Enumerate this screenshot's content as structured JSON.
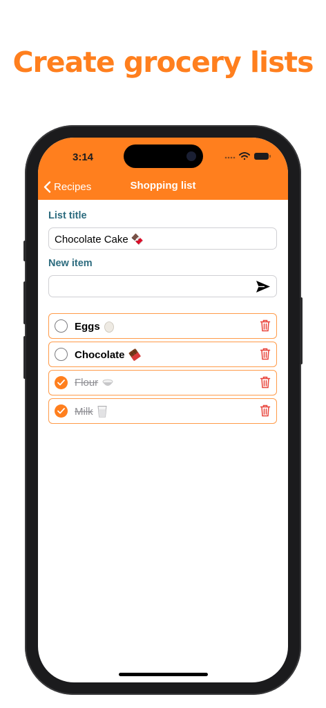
{
  "promo": {
    "headline": "Create grocery lists"
  },
  "status_bar": {
    "time": "3:14",
    "icons": [
      "signal-dots-icon",
      "wifi-icon",
      "battery-icon"
    ]
  },
  "nav": {
    "back_label": "Recipes",
    "title": "Shopping list"
  },
  "form": {
    "title_label": "List title",
    "title_value": "Chocolate Cake 🍫",
    "new_item_label": "New item",
    "new_item_value": "",
    "send_icon": "paper-plane-icon"
  },
  "items": [
    {
      "text": "Eggs",
      "emoji": "egg-icon",
      "checked": false
    },
    {
      "text": "Chocolate",
      "emoji": "chocolate-icon",
      "checked": false
    },
    {
      "text": "Flour",
      "emoji": "flour-bowl-icon",
      "checked": true
    },
    {
      "text": "Milk",
      "emoji": "milk-glass-icon",
      "checked": true
    }
  ],
  "colors": {
    "accent": "#FF7F1E",
    "label": "#2c6b7e",
    "delete": "#E8433A"
  }
}
